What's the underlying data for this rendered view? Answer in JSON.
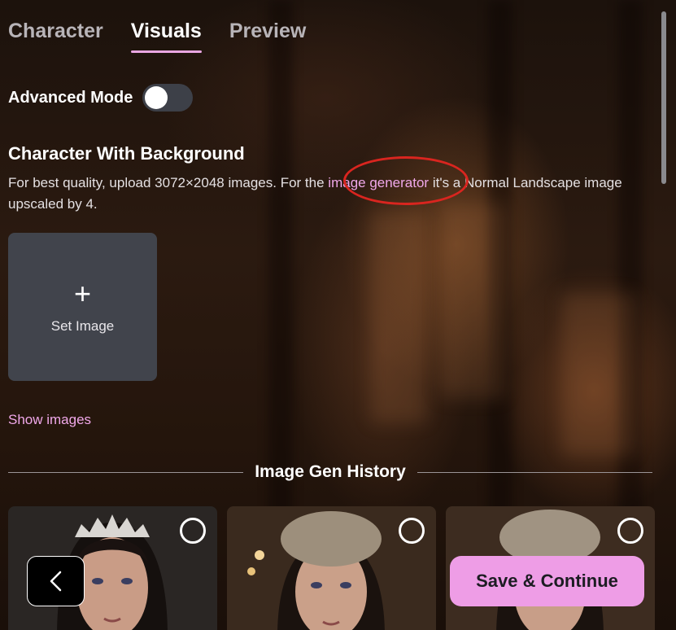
{
  "tabs": [
    {
      "label": "Character",
      "active": false
    },
    {
      "label": "Visuals",
      "active": true
    },
    {
      "label": "Preview",
      "active": false
    }
  ],
  "advanced_mode": {
    "label": "Advanced Mode",
    "enabled": false
  },
  "section": {
    "title": "Character With Background",
    "desc_before": "For best quality, upload 3072×2048 images. For the ",
    "desc_link": "image generator",
    "desc_after": " it's a Normal Landscape image upscaled by 4."
  },
  "set_image": {
    "plus_icon": "+",
    "label": "Set Image"
  },
  "show_images_link": "Show images",
  "history": {
    "title": "Image Gen History"
  },
  "buttons": {
    "save": "Save & Continue",
    "back_icon": "chevron-left-icon"
  },
  "colors": {
    "accent": "#ee9de6",
    "link": "#f0a8ea",
    "annotation": "#d9251f"
  }
}
